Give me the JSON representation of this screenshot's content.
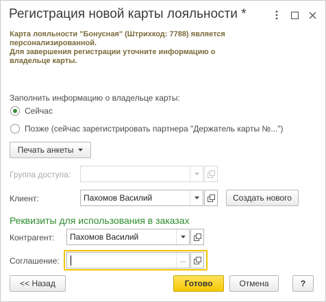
{
  "window": {
    "title": "Регистрация новой карты лояльности *"
  },
  "info": {
    "line1": "Карта лояльности \"Бонусная\" (Штрихкод: 7788) является",
    "line2": "персонализированной.",
    "line3": "Для завершения регистрации уточните информацию о",
    "line4": "владельце карты."
  },
  "fill_info": {
    "label": "Заполнить информацию о владельце карты:",
    "option_now": "Сейчас",
    "option_later": "Позже (сейчас зарегистрировать партнера \"Держатель карты №...\")",
    "selected": "now"
  },
  "print_button": {
    "label": "Печать анкеты"
  },
  "access_group": {
    "label": "Группа доступа:",
    "value": ""
  },
  "client": {
    "label": "Клиент:",
    "value": "Пахомов Василий",
    "create_label": "Создать нового"
  },
  "order_details": {
    "title": "Реквизиты для использования в заказах",
    "counterparty_label": "Контрагент:",
    "counterparty_value": "Пахомов Василий",
    "agreement_label": "Соглашение:",
    "agreement_value": ""
  },
  "footer": {
    "back_label": "<< Назад",
    "done_label": "Готово",
    "cancel_label": "Отмена",
    "help_label": "?"
  },
  "colors": {
    "accent_green": "#2e8b2e",
    "primary_yellow": "#f5c800",
    "info_text": "#7a6a3a"
  }
}
